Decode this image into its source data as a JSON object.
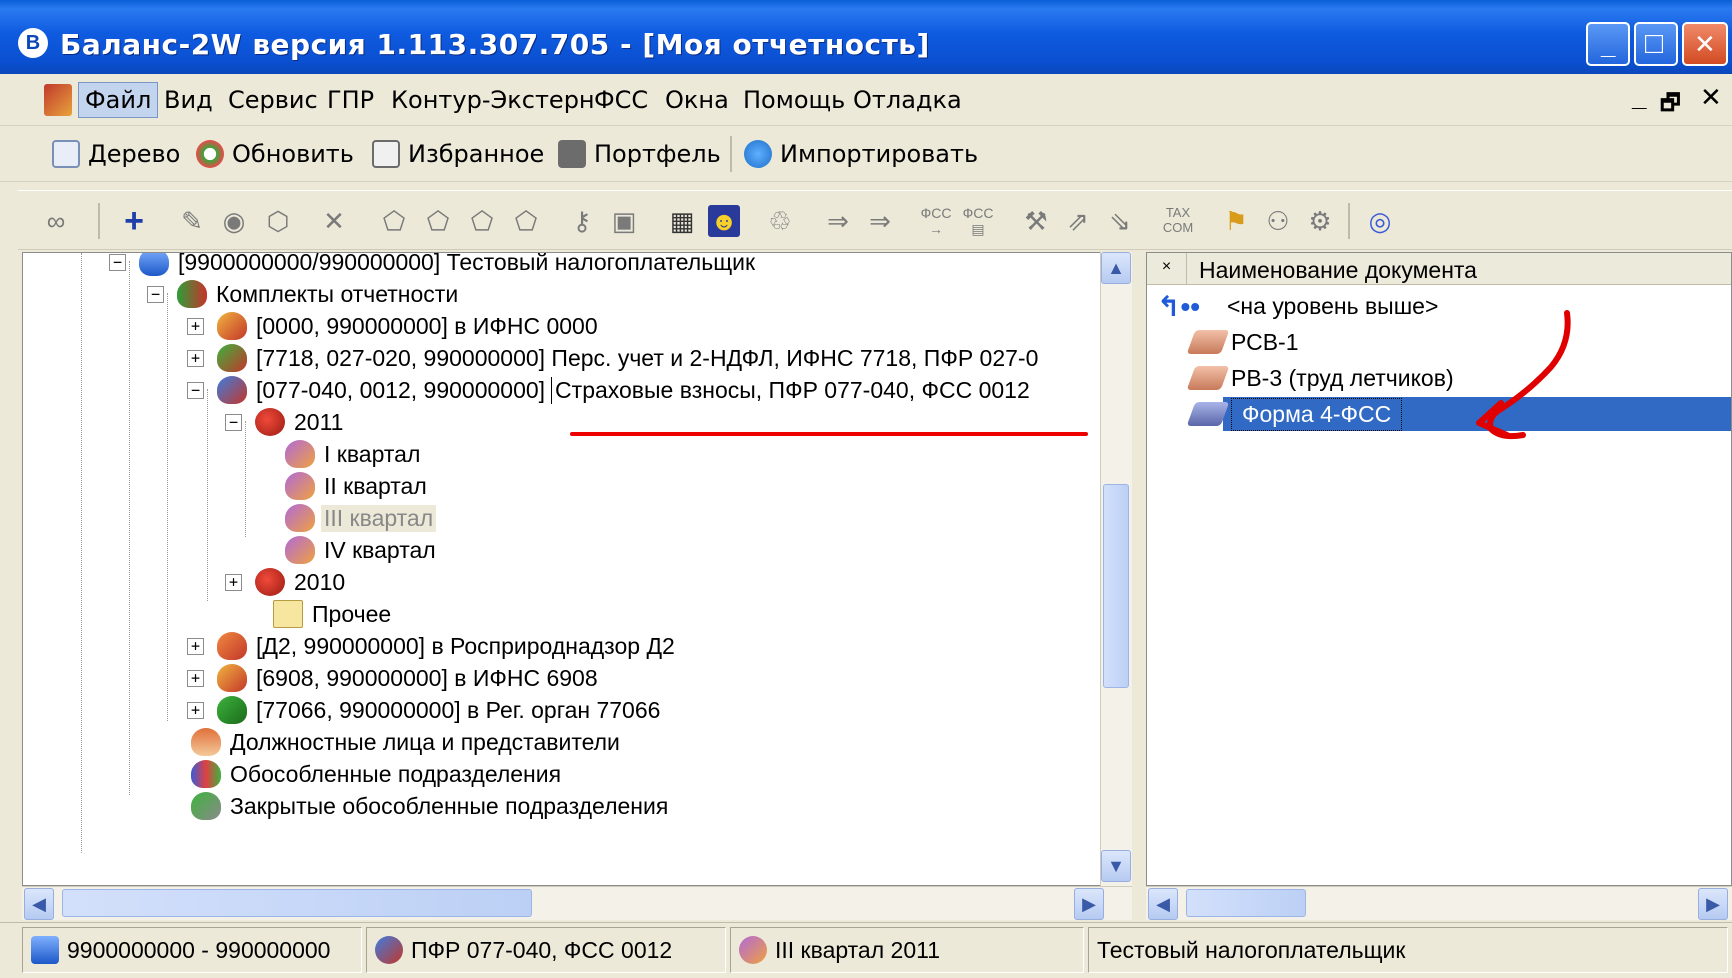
{
  "window": {
    "title": "Баланс-2W  версия 1.113.307.705 - [Моя отчетность]",
    "app_icon_glyph": "В",
    "minimize_glyph": "_",
    "maximize_glyph": "□",
    "close_glyph": "✕"
  },
  "menu": {
    "items": [
      "Файл",
      "Вид",
      "Сервис",
      "ГПР",
      "Контур-Экстерн",
      "ФСС",
      "Окна",
      "Помощь",
      "Отладка"
    ],
    "mdi_minimize": "_",
    "mdi_restore": "🗗",
    "mdi_close": "✕"
  },
  "toolbar1": {
    "tree": "Дерево",
    "refresh": "Обновить",
    "favorites": "Избранное",
    "portfolio": "Портфель",
    "import": "Импортировать"
  },
  "tree": {
    "taxpayer": "[9900000000/990000000] Тестовый налогоплательщик",
    "sets": "Комплекты отчетности",
    "set1": "[0000, 990000000] в ИФНС 0000",
    "set2": "[7718, 027-020, 990000000] Перс. учет и 2-НДФЛ, ИФНС 7718, ПФР 027-0",
    "set3_code": "[077-040, 0012, 990000000]",
    "set3_name": "Страховые взносы, ПФР 077-040, ФСС 0012",
    "year2011": "2011",
    "q1": "I квартал",
    "q2": "II квартал",
    "q3": "III квартал",
    "q4": "IV квартал",
    "year2010": "2010",
    "other": "Прочее",
    "set4": "[Д2, 990000000] в Росприроднадзор Д2",
    "set5": "[6908, 990000000] в ИФНС 6908",
    "set6": "[77066, 990000000] в Рег. орган 77066",
    "officials": "Должностные лица и представители",
    "subdivisions": "Обособленные подразделения",
    "closed_subdivisions": "Закрытые обособленные подразделения"
  },
  "documents": {
    "corner": "×",
    "column_header": "Наименование документа",
    "up": "<на уровень выше>",
    "rows": [
      "РСВ-1",
      "РВ-3 (труд летчиков)",
      "Форма 4-ФСС"
    ],
    "selected_index": 2
  },
  "statusbar": {
    "ids": "9900000000 - 990000000",
    "set": "ПФР 077-040, ФСС 0012",
    "period": "III квартал 2011",
    "taxpayer": "Тестовый налогоплательщик"
  },
  "colors": {
    "titlebar": "#0b47b8",
    "selection": "#316ac5",
    "annotation": "#e00000"
  }
}
